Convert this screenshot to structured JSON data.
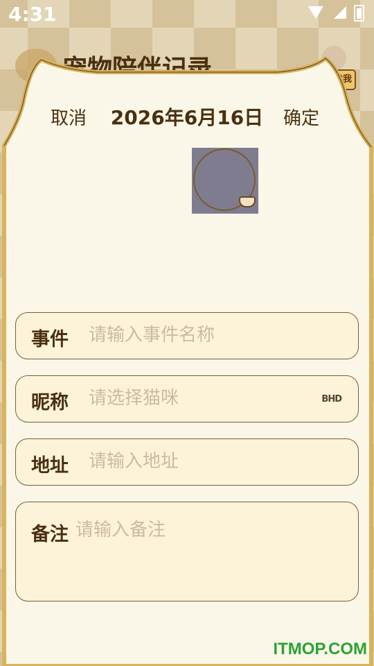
{
  "status_bar": {
    "time": "4:31"
  },
  "background": {
    "title": "宠物陪伴记录",
    "badge": "找我"
  },
  "header": {
    "cancel_label": "取消",
    "date": "2026年6月16日",
    "confirm_label": "确定"
  },
  "form": {
    "event": {
      "label": "事件",
      "placeholder": "请输入事件名称"
    },
    "nickname": {
      "label": "昵称",
      "placeholder": "请选择猫咪",
      "dropdown_glyph": "BHD"
    },
    "address": {
      "label": "地址",
      "placeholder": "请输入地址"
    },
    "notes": {
      "label": "备注",
      "placeholder": "请输入备注"
    }
  },
  "watermark": "ITMOP.COM",
  "colors": {
    "sheet": "#fbf7e8",
    "field": "#fdf3d9",
    "border": "#7a5c32",
    "text": "#4a3010",
    "placeholder": "#cbbba0",
    "accent_outline": "#d9b35a"
  }
}
